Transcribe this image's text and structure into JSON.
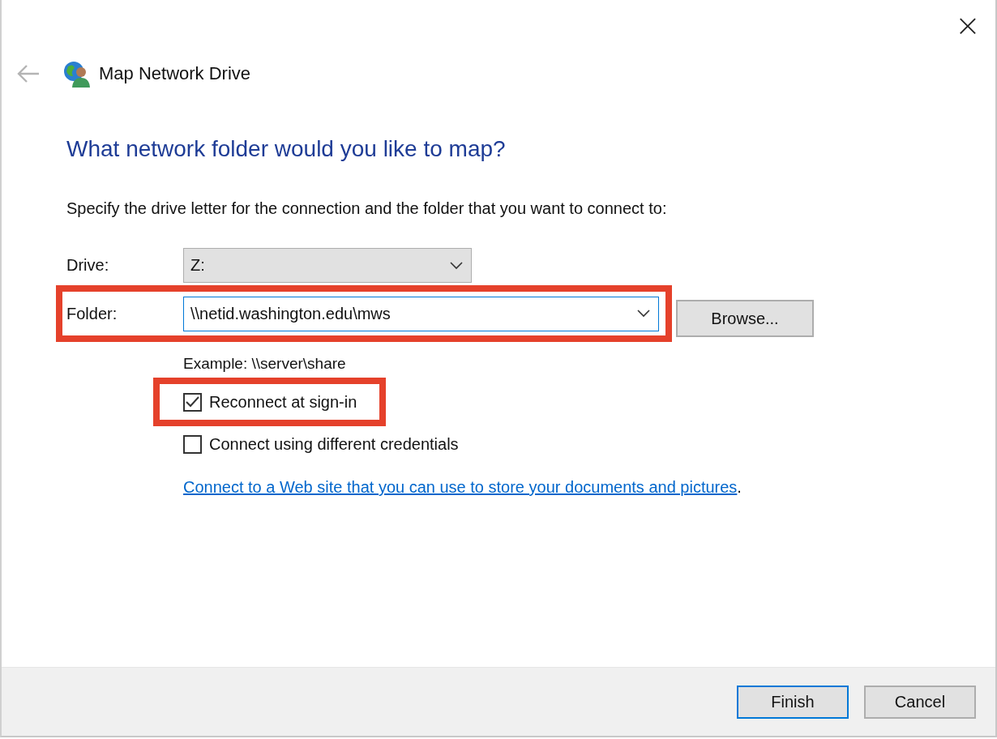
{
  "window": {
    "title": "Map Network Drive",
    "close": "×"
  },
  "heading": "What network folder would you like to map?",
  "instruction": "Specify the drive letter for the connection and the folder that you want to connect to:",
  "drive": {
    "label": "Drive:",
    "value": "Z:"
  },
  "folder": {
    "label": "Folder:",
    "value": "\\\\netid.washington.edu\\mws",
    "highlighted": true
  },
  "browse_button": "Browse...",
  "example": "Example: \\\\server\\share",
  "options": [
    {
      "label": "Reconnect at sign-in",
      "checked": true,
      "highlighted": true
    },
    {
      "label": "Connect using different credentials",
      "checked": false,
      "highlighted": false
    }
  ],
  "link": {
    "text": "Connect to a Web site that you can use to store your documents and pictures",
    "suffix": "."
  },
  "buttons": [
    {
      "label": "Finish",
      "selected": true
    },
    {
      "label": "Cancel",
      "selected": false
    }
  ]
}
